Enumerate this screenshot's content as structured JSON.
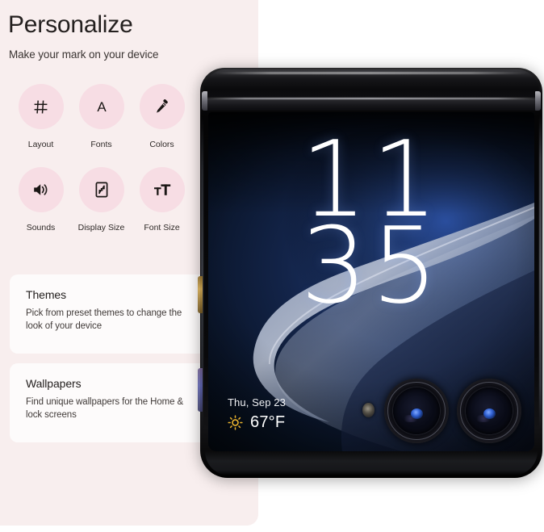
{
  "panel": {
    "title": "Personalize",
    "subtitle": "Make your mark on your device",
    "accent_bg": "#f8eeee",
    "icon_bg": "#f7dde4"
  },
  "quick_settings": [
    {
      "label": "Layout",
      "icon": "grid-icon"
    },
    {
      "label": "Fonts",
      "icon": "letter-a-icon"
    },
    {
      "label": "Colors",
      "icon": "eyedropper-icon"
    },
    {
      "label": "Sounds",
      "icon": "speaker-icon"
    },
    {
      "label": "Display Size",
      "icon": "display-size-icon"
    },
    {
      "label": "Font Size",
      "icon": "font-size-icon"
    }
  ],
  "cards": [
    {
      "title": "Themes",
      "description": "Pick from preset themes to change the look of your device"
    },
    {
      "title": "Wallpapers",
      "description": "Find unique wallpapers for the Home & lock screens"
    }
  ],
  "phone": {
    "cover_screen": {
      "time_hours": "11",
      "time_minutes": "35",
      "date": "Thu, Sep 23",
      "temperature": "67°F",
      "weather_icon": "sun-icon"
    },
    "hardware": {
      "camera_lens_count": 2,
      "flash_sensor": "flash-sensor",
      "power_button": "power-button",
      "volume_button": "volume-button"
    }
  }
}
